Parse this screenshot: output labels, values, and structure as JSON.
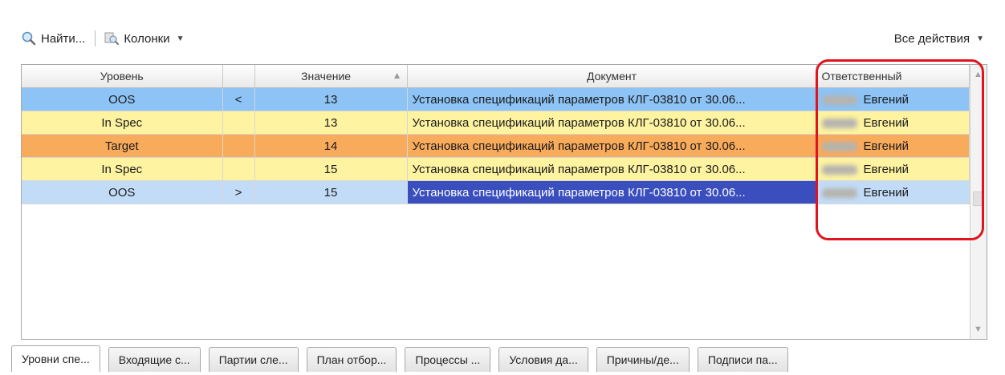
{
  "toolbar": {
    "find_label": "Найти...",
    "columns_label": "Колонки",
    "all_actions_label": "Все действия"
  },
  "columns": {
    "level": "Уровень",
    "value": "Значение",
    "document": "Документ",
    "responsible": "Ответственный"
  },
  "rows": [
    {
      "level": "OOS",
      "dir": "<",
      "value": "13",
      "document": "Установка спецификаций параметров КЛГ-03810 от 30.06...",
      "responsible": "Евгений",
      "color": "#8dc3f5"
    },
    {
      "level": "In Spec",
      "dir": "",
      "value": "13",
      "document": "Установка спецификаций параметров КЛГ-03810 от 30.06...",
      "responsible": "Евгений",
      "color": "#fef3a0"
    },
    {
      "level": "Target",
      "dir": "",
      "value": "14",
      "document": "Установка спецификаций параметров КЛГ-03810 от 30.06...",
      "responsible": "Евгений",
      "color": "#f9ab5c"
    },
    {
      "level": "In Spec",
      "dir": "",
      "value": "15",
      "document": "Установка спецификаций параметров КЛГ-03810 от 30.06...",
      "responsible": "Евгений",
      "color": "#fef3a0"
    },
    {
      "level": "OOS",
      "dir": ">",
      "value": "15",
      "document": "Установка спецификаций параметров КЛГ-03810 от 30.06...",
      "responsible": "Евгений",
      "color": "#c2dcf8"
    }
  ],
  "tabs": [
    "Уровни спе...",
    "Входящие с...",
    "Партии сле...",
    "План отбор...",
    "Процессы ...",
    "Условия да...",
    "Причины/де...",
    "Подписи па..."
  ],
  "colors": {
    "selection": "#3a4fbd",
    "highlight": "#e0141e"
  }
}
